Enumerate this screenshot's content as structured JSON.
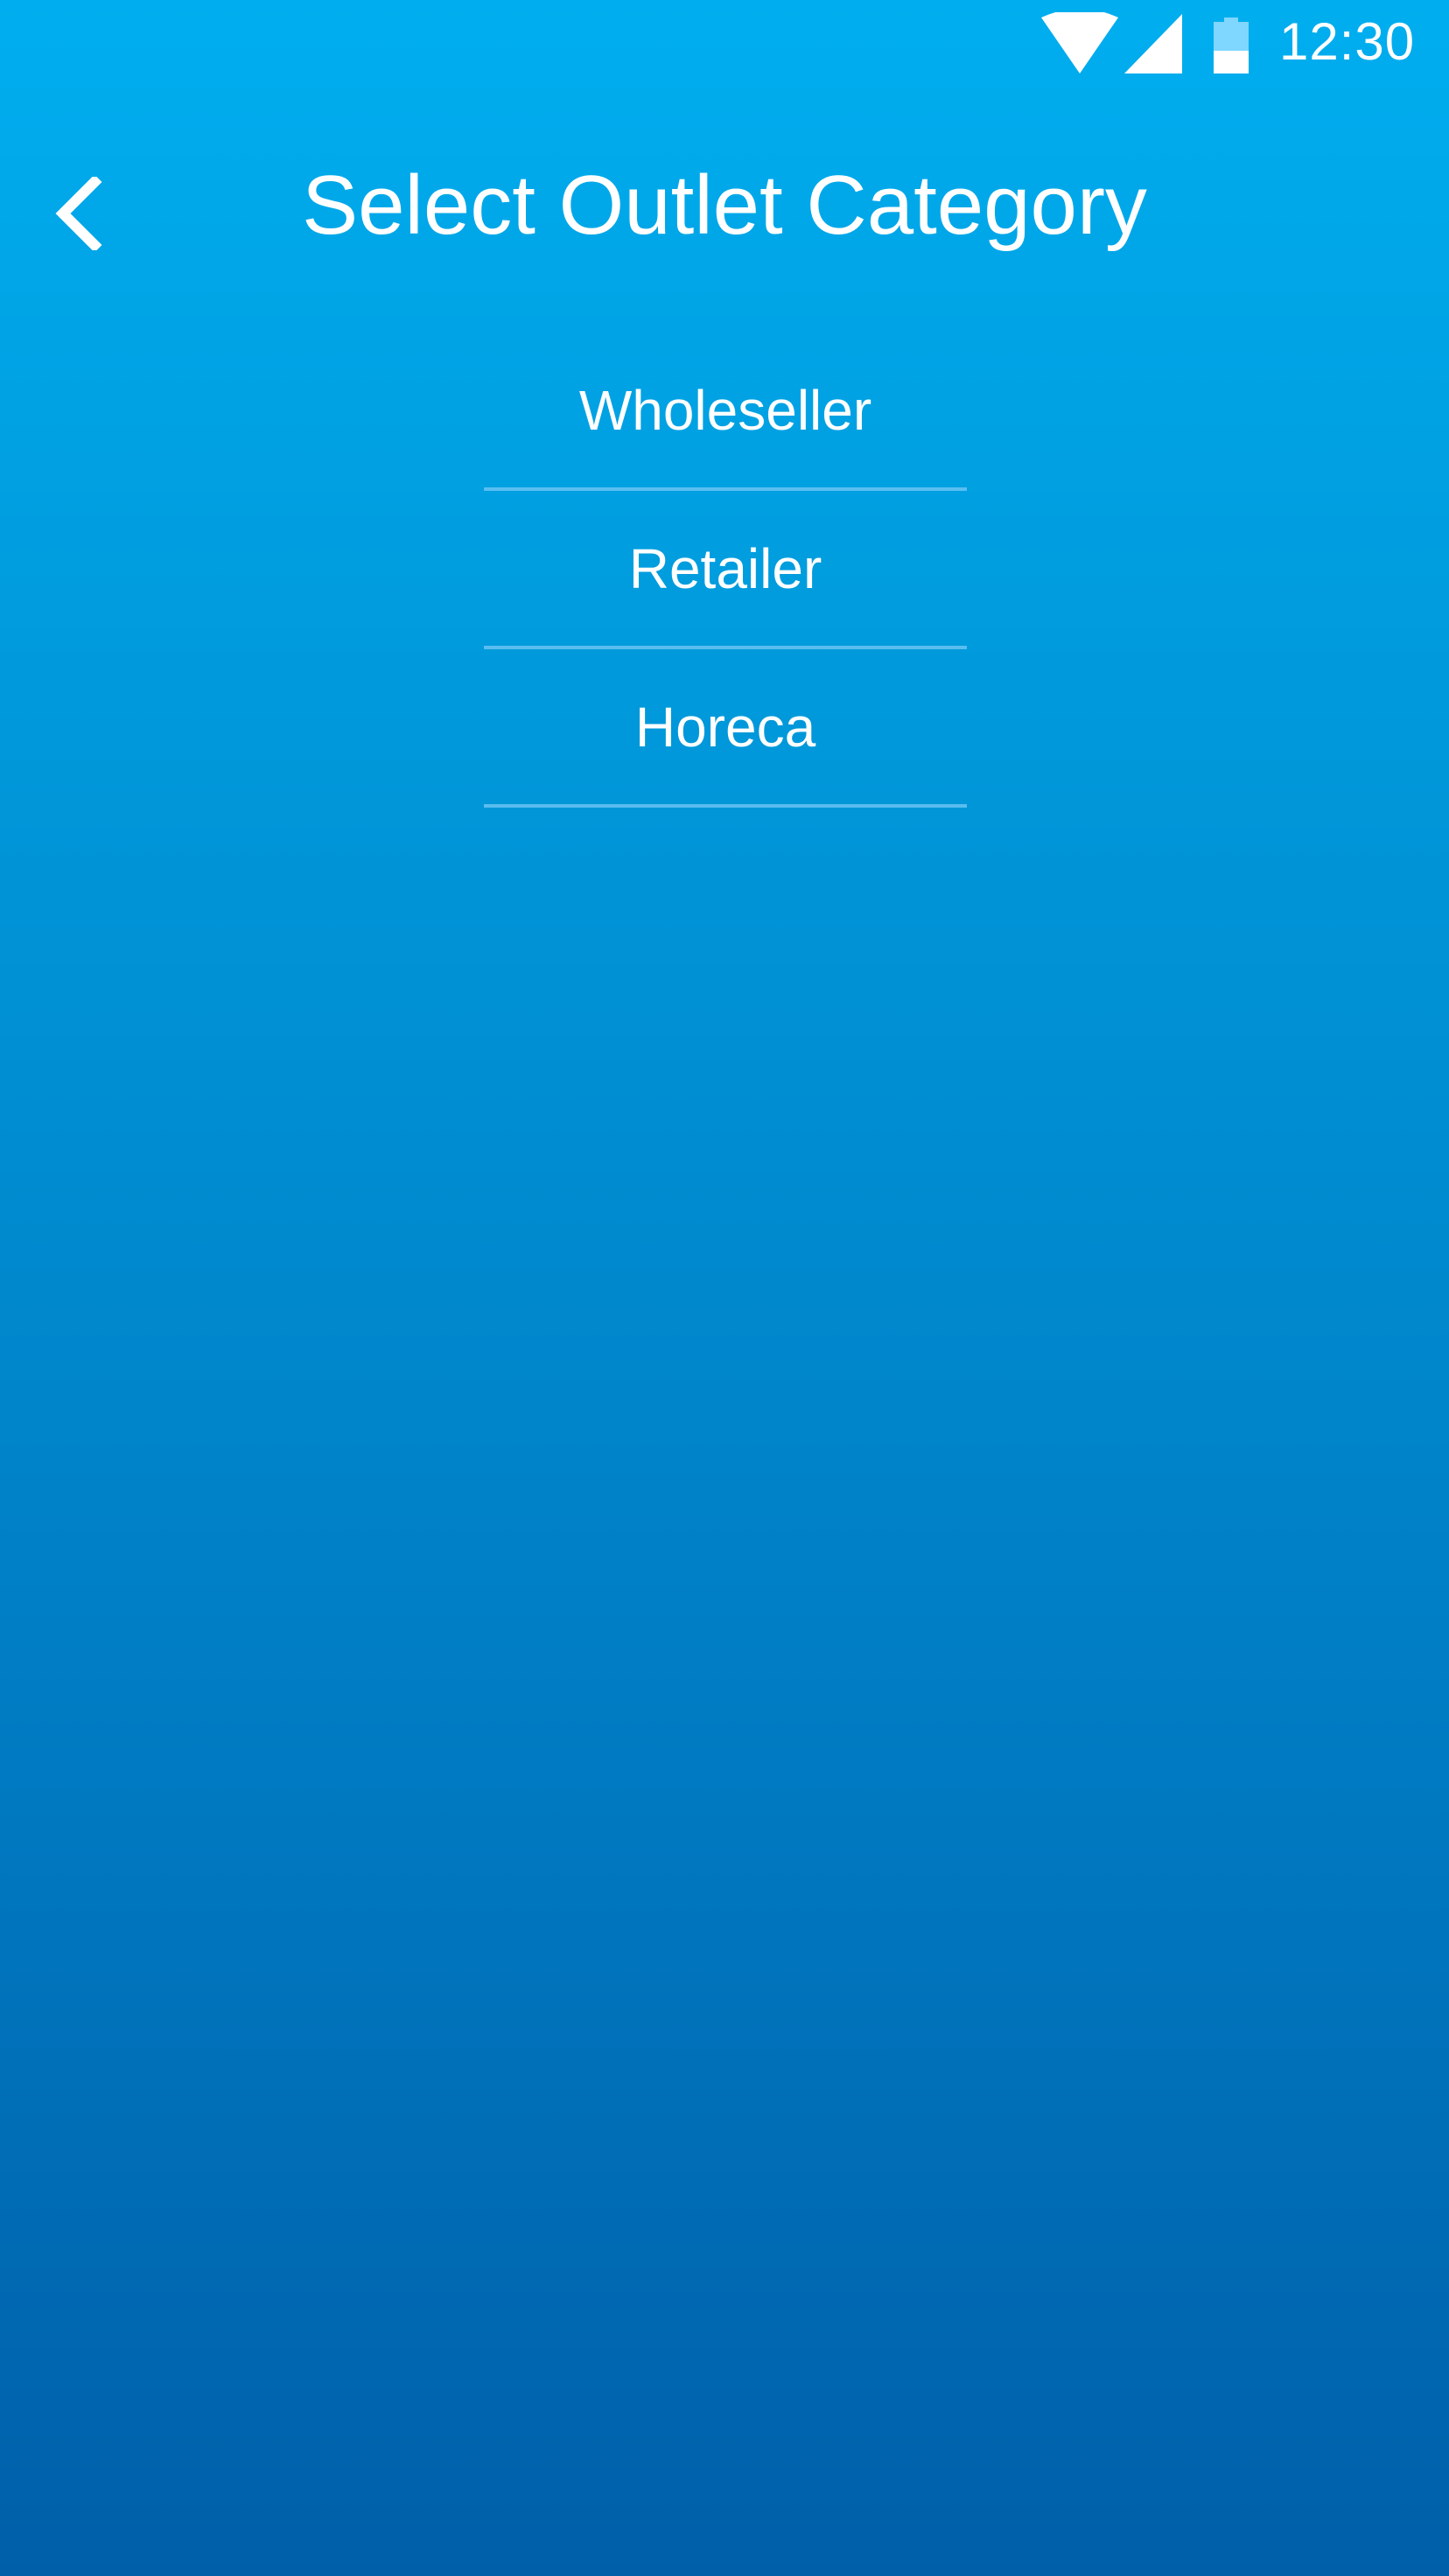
{
  "status_bar": {
    "time": "12:30",
    "icons": [
      "wifi-icon",
      "cell-signal-icon",
      "battery-icon"
    ]
  },
  "header": {
    "title": "Select Outlet Category",
    "back_icon": "chevron-left-icon"
  },
  "categories": [
    {
      "label": "Wholeseller"
    },
    {
      "label": "Retailer"
    },
    {
      "label": "Horeca"
    }
  ],
  "colors": {
    "background_top": "#00aeef",
    "background_bottom": "#005fa9",
    "text": "#ffffff",
    "divider": "#78c8f5"
  }
}
